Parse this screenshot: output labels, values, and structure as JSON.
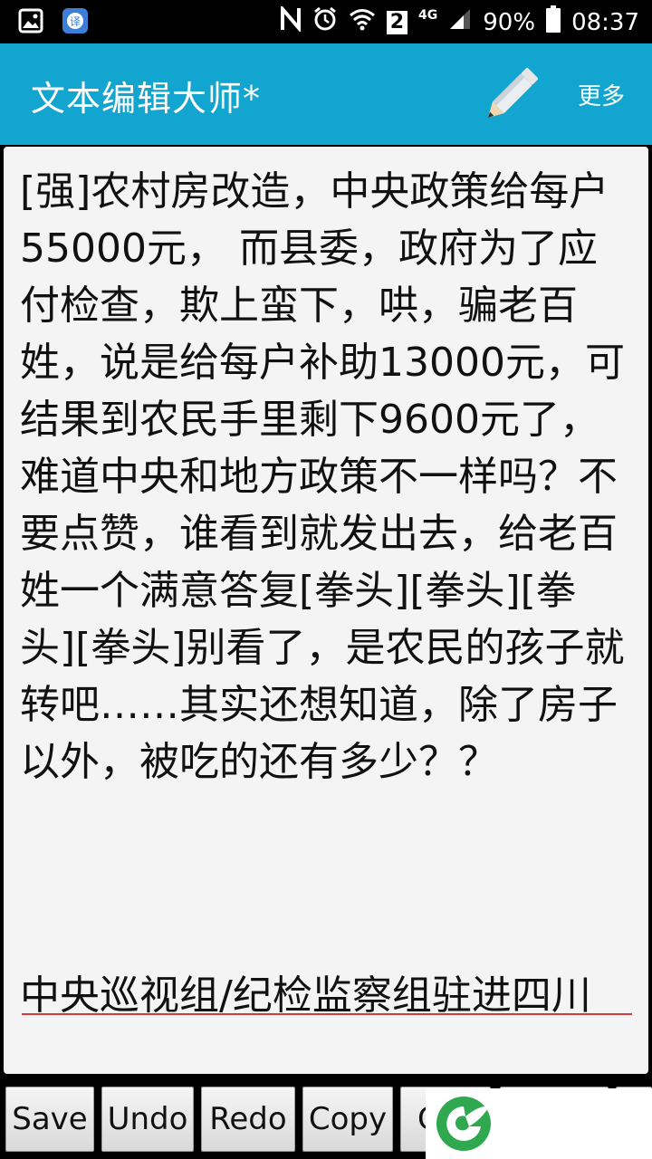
{
  "status_bar": {
    "left_icons": [
      "gallery-icon",
      "translate-app-icon"
    ],
    "right_icons": [
      "nfc-icon",
      "alarm-icon",
      "wifi-icon",
      "signal-icon",
      "battery-icon"
    ],
    "sim": "2",
    "network": "4G",
    "battery": "90%",
    "time": "08:37"
  },
  "app_bar": {
    "title": "文本编辑大师*",
    "more_label": "更多",
    "edit_icon": "pencil-icon"
  },
  "editor": {
    "text": "[强]农村房改造，中央政策给每户55000元， 而县委，政府为了应付检查，欺上蛮下，哄，骗老百姓，说是给每户补助13000元，可结果到农民手里剩下9600元了，难道中央和地方政策不一样吗？不要点赞，谁看到就发出去，给老百姓一个满意答复[拳头][拳头][拳头][拳头]别看了，是农民的孩子就转吧……其实还想知道，除了房子以外，被吃的还有多少？？",
    "tail_text": "中央巡视组/纪检监察组驻进四川"
  },
  "toolbar": {
    "save_label": "Save",
    "undo_label": "Undo",
    "redo_label": "Redo",
    "copy_label": "Copy",
    "partial_label": "C"
  },
  "colors": {
    "app_bar": "#12a5cf",
    "editor_bg": "#f4f4f4",
    "logo_green": "#2fa84f"
  }
}
